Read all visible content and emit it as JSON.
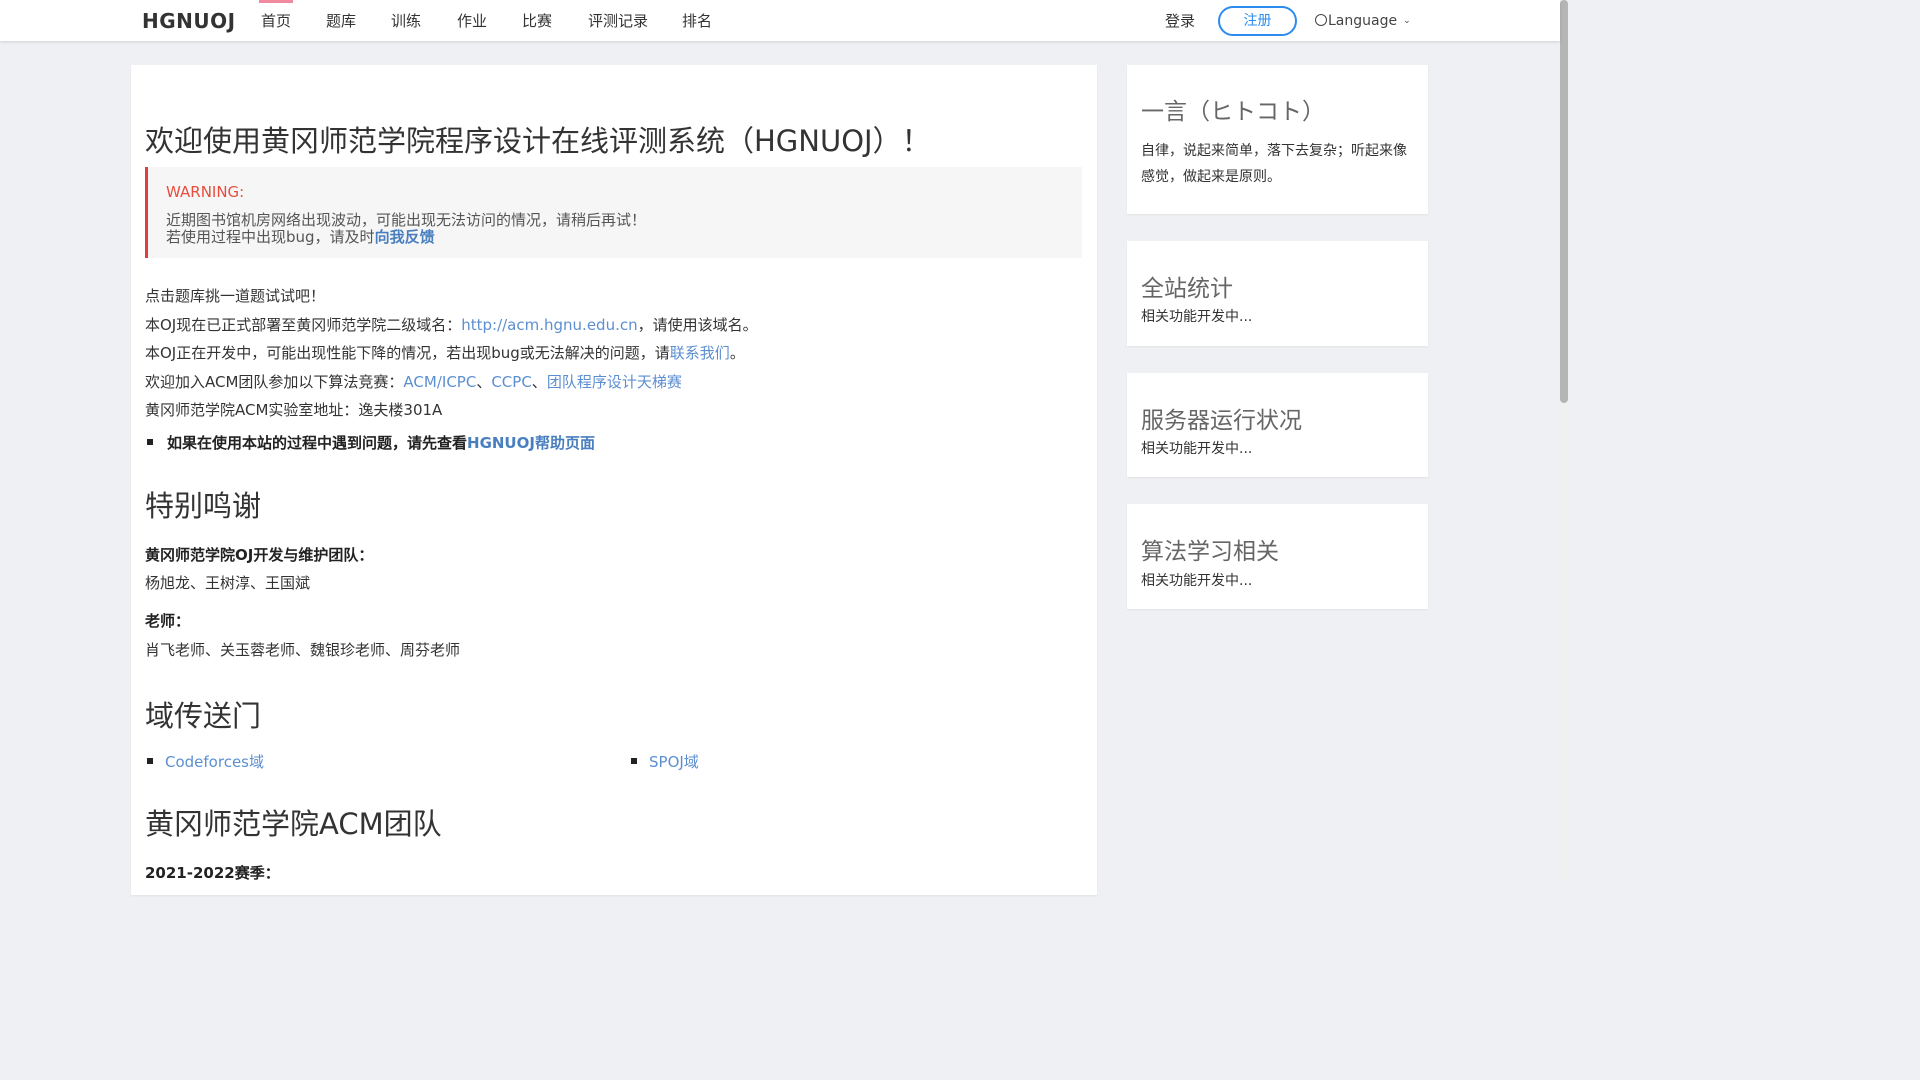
{
  "nav": {
    "logo": "HGNUOJ",
    "items": [
      "首页",
      "题库",
      "训练",
      "作业",
      "比赛",
      "评测记录",
      "排名"
    ],
    "login": "登录",
    "register": "注册",
    "language": "Language"
  },
  "main": {
    "title": "欢迎使用黄冈师范学院程序设计在线评测系统（HGNUOJ）！",
    "warning": {
      "title": "WARNING:",
      "line1": "近期图书馆机房网络出现波动，可能出现无法访问的情况，请稍后再试！",
      "line2_prefix": "若使用过程中出现bug，请及时",
      "line2_link": "向我反馈"
    },
    "paragraphs": {
      "p1": "点击题库挑一道题试试吧！",
      "p2_prefix": "本OJ现在已正式部署至黄冈师范学院二级域名：",
      "p2_link": "http://acm.hgnu.edu.cn",
      "p2_suffix": "，请使用该域名。",
      "p3_prefix": "本OJ正在开发中，可能出现性能下降的情况，若出现bug或无法解决的问题，请",
      "p3_link": "联系我们",
      "p3_suffix": "。",
      "p4_prefix": "欢迎加入ACM团队参加以下算法竞赛：",
      "p4_link1": "ACM/ICPC",
      "p4_sep1": "、",
      "p4_link2": "CCPC",
      "p4_sep2": "、",
      "p4_link3": "团队程序设计天梯赛",
      "p5": "黄冈师范学院ACM实验室地址：逸夫楼301A",
      "bullet_prefix": "如果在使用本站的过程中遇到问题，请先查看",
      "bullet_link": "HGNUOJ帮助页面"
    },
    "thanks": {
      "heading": "特别鸣谢",
      "team_label": "黄冈师范学院OJ开发与维护团队：",
      "team_members": "杨旭龙、王树淳、王国斌",
      "teacher_label": "老师：",
      "teachers": "肖飞老师、关玉蓉老师、魏银珍老师、周芬老师"
    },
    "portal": {
      "heading": "域传送门",
      "links": [
        "Codeforces域",
        "SPOJ域"
      ]
    },
    "acm": {
      "heading": "黄冈师范学院ACM团队",
      "season": "2021-2022赛季："
    }
  },
  "sidebar": {
    "hitokoto": {
      "title": "一言（ヒトコト）",
      "body": "自律，说起来简单，落下去复杂；听起来像感觉，做起来是原则。"
    },
    "stats": {
      "title": "全站统计",
      "body": "相关功能开发中..."
    },
    "server": {
      "title": "服务器运行状况",
      "body": "相关功能开发中..."
    },
    "algo": {
      "title": "算法学习相关",
      "body": "相关功能开发中..."
    }
  },
  "colors": {
    "accent": "#2d8cf0",
    "link": "#5c8fd1",
    "warning": "#e84d3d",
    "nav_active": "#f18aa1"
  }
}
